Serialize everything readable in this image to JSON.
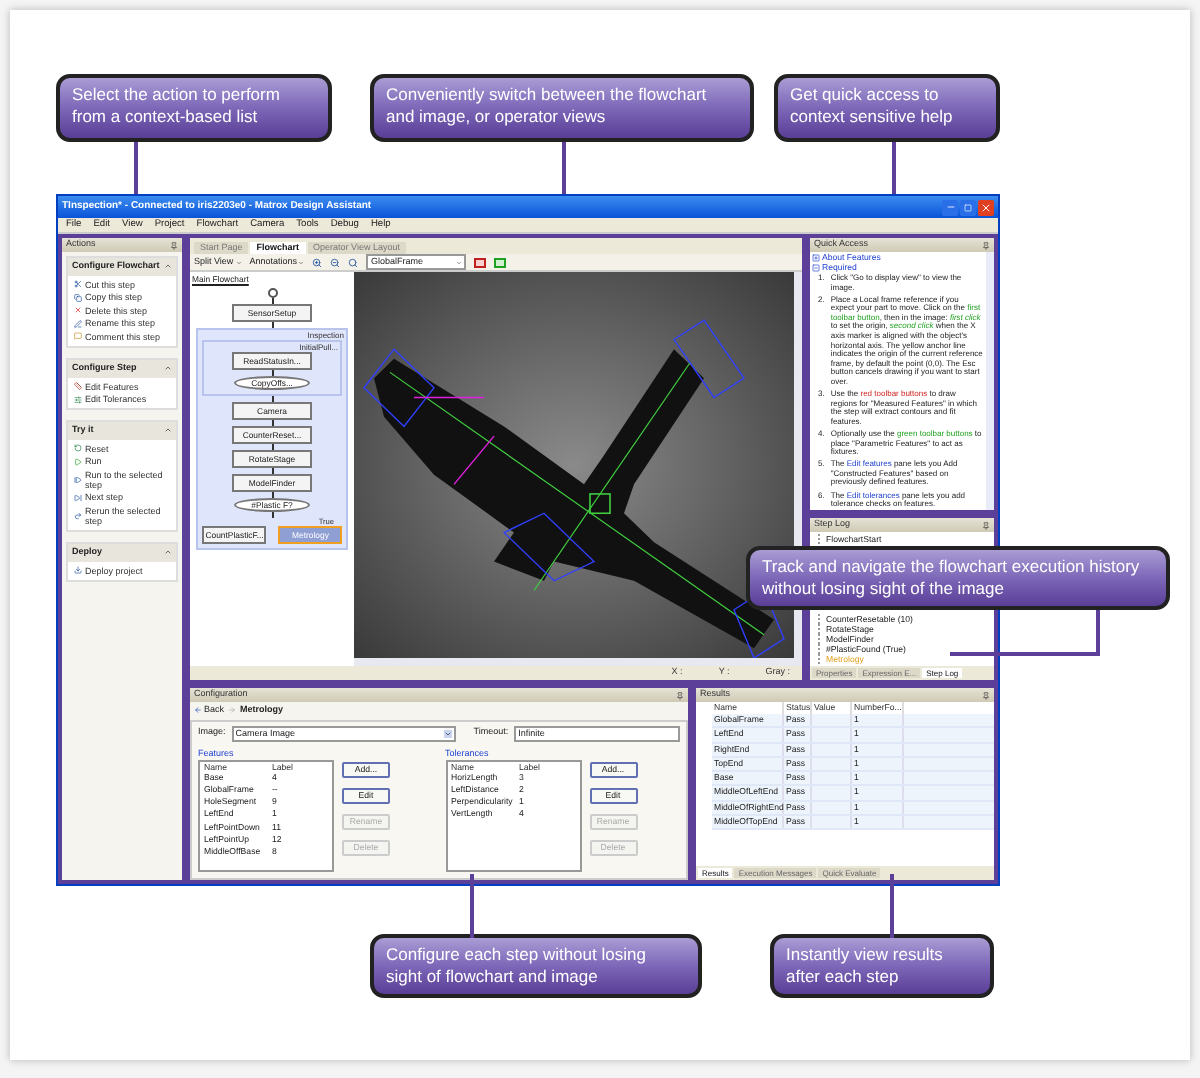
{
  "callouts_top": [
    {
      "text": "Select the action to perform from a context-based list"
    },
    {
      "text": "Conveniently switch between the flowchart and image, or operator views"
    },
    {
      "text": "Get quick access to context sensitive help"
    }
  ],
  "window": {
    "title": "TInspection* - Connected to iris2203e0 - Matrox Design Assistant",
    "menu": [
      "File",
      "Edit",
      "View",
      "Project",
      "Flowchart",
      "Camera",
      "Tools",
      "Debug",
      "Help"
    ]
  },
  "actions": {
    "title": "Actions",
    "sections": [
      {
        "title": "Configure Flowchart",
        "items": [
          "Cut this step",
          "Copy this step",
          "Delete this step",
          "Rename this step",
          "Comment this step"
        ]
      },
      {
        "title": "Configure Step",
        "items": [
          "Edit Features",
          "Edit Tolerances"
        ]
      },
      {
        "title": "Try it",
        "items": [
          "Reset",
          "Run",
          "Run to the selected step",
          "Next step",
          "Rerun the selected step"
        ]
      },
      {
        "title": "Deploy",
        "items": [
          "Deploy project"
        ]
      }
    ]
  },
  "center": {
    "tabs": [
      {
        "label": "Start Page",
        "selected": false
      },
      {
        "label": "Flowchart",
        "selected": true
      },
      {
        "label": "Operator View Layout",
        "selected": false
      }
    ],
    "toolbar": {
      "view": "Split View",
      "annotations": "Annotations",
      "frame": "GlobalFrame"
    },
    "flowchart": {
      "label": "Main Flowchart",
      "nodes": [
        {
          "kind": "start"
        },
        {
          "kind": "step",
          "label": "SensorSetup",
          "selected": false
        },
        {
          "kind": "group",
          "label": "Inspection",
          "children": [
            {
              "kind": "group",
              "label": "InitialPull...",
              "children": [
                {
                  "kind": "step",
                  "label": "ReadStatusIn...",
                  "selected": false
                },
                {
                  "kind": "decision",
                  "label": "CopyOffs..."
                }
              ]
            },
            {
              "kind": "step",
              "label": "Camera",
              "selected": false
            },
            {
              "kind": "step",
              "label": "CounterReset...",
              "selected": false
            },
            {
              "kind": "step",
              "label": "RotateStage",
              "selected": false
            },
            {
              "kind": "step",
              "label": "ModelFinder",
              "selected": false
            },
            {
              "kind": "decision",
              "label": "#Plastic F?"
            },
            {
              "kind": "branch",
              "label": "True",
              "children": [
                {
                  "kind": "step",
                  "label": "CountPlasticF...",
                  "selected": false
                },
                {
                  "kind": "step",
                  "label": "Metrology",
                  "selected": true
                }
              ]
            }
          ]
        }
      ]
    },
    "image_status": [
      "X :",
      "Y :",
      "Gray :"
    ]
  },
  "quick_access": {
    "title": "Quick Access",
    "links": [
      {
        "label": "About Features",
        "expanded": false
      },
      {
        "label": "Required",
        "expanded": true
      }
    ],
    "numbers": [
      "1.",
      "2.",
      "3.",
      "4.",
      "5.",
      "6."
    ],
    "steps": [
      [
        {
          "kind": "text",
          "text": "Click \"Go to display view\" to view the image."
        }
      ],
      [
        {
          "kind": "text",
          "text": "Place a Local frame reference if you expect your part to move. Click on the "
        },
        {
          "kind": "green",
          "text": "first toolbar button"
        },
        {
          "kind": "text",
          "text": ", then in the image: "
        },
        {
          "kind": "green_italic",
          "text": "first click"
        },
        {
          "kind": "text",
          "text": " to set the origin, "
        },
        {
          "kind": "green_italic",
          "text": "second click"
        },
        {
          "kind": "text",
          "text": " when the X axis marker is aligned with the object's horizontal axis. The yellow anchor line indicates the origin of the current reference frame, by default the point (0,0). The Esc button cancels drawing if you want to start over."
        }
      ],
      [
        {
          "kind": "text",
          "text": "Use the "
        },
        {
          "kind": "red",
          "text": "red toolbar buttons"
        },
        {
          "kind": "text",
          "text": " to draw regions for \"Measured Features\" in which the step will extract contours and fit features."
        }
      ],
      [
        {
          "kind": "text",
          "text": "Optionally use the "
        },
        {
          "kind": "green",
          "text": "green toolbar buttons"
        },
        {
          "kind": "text",
          "text": " to place \"Parametric Features\" to act as fixtures."
        }
      ],
      [
        {
          "kind": "text",
          "text": "The "
        },
        {
          "kind": "blue",
          "text": "Edit features"
        },
        {
          "kind": "text",
          "text": " pane lets you Add \"Constructed Features\" based on previously defined features."
        }
      ],
      [
        {
          "kind": "text",
          "text": "The "
        },
        {
          "kind": "blue",
          "text": "Edit tolerances"
        },
        {
          "kind": "text",
          "text": " pane lets you add tolerance checks on features."
        }
      ]
    ]
  },
  "step_log": {
    "title": "Step Log",
    "items": [
      {
        "label": "FlowchartStart",
        "selected": false
      },
      {
        "label": "CounterResetable (10)",
        "selected": false
      },
      {
        "label": "RotateStage",
        "selected": false
      },
      {
        "label": "ModelFinder",
        "selected": false
      },
      {
        "label": "#PlasticFound (True)",
        "selected": false
      },
      {
        "label": "Metrology",
        "selected": true
      }
    ],
    "tabs": [
      {
        "label": "Properties",
        "selected": false
      },
      {
        "label": "Expression E...",
        "selected": false
      },
      {
        "label": "Step Log",
        "selected": true
      }
    ]
  },
  "callout_side": {
    "text": "Track and navigate the flowchart execution history without losing sight of the image"
  },
  "configuration": {
    "title": "Configuration",
    "back": "Back",
    "step": "Metrology",
    "image_label": "Image:",
    "image_value": "Camera Image",
    "timeout_label": "Timeout:",
    "timeout_value": "Infinite",
    "features": {
      "title": "Features",
      "columns": [
        "Name",
        "Label"
      ],
      "rows": [
        [
          "Base",
          "4"
        ],
        [
          "GlobalFrame",
          "--"
        ],
        [
          "HoleSegment",
          "9"
        ],
        [
          "LeftEnd",
          "1"
        ],
        [
          "LeftPointDown",
          "11"
        ],
        [
          "LeftPointUp",
          "12"
        ],
        [
          "MiddleOffBase",
          "8"
        ]
      ],
      "buttons": [
        {
          "label": "Add...",
          "disabled": false
        },
        {
          "label": "Edit",
          "disabled": false
        },
        {
          "label": "Rename",
          "disabled": true
        },
        {
          "label": "Delete",
          "disabled": true
        }
      ]
    },
    "tolerances": {
      "title": "Tolerances",
      "columns": [
        "Name",
        "Label"
      ],
      "rows": [
        [
          "HorizLength",
          "3"
        ],
        [
          "LeftDistance",
          "2"
        ],
        [
          "Perpendicularity",
          "1"
        ],
        [
          "VertLength",
          "4"
        ]
      ],
      "buttons": [
        {
          "label": "Add...",
          "disabled": false
        },
        {
          "label": "Edit",
          "disabled": false
        },
        {
          "label": "Rename",
          "disabled": true
        },
        {
          "label": "Delete",
          "disabled": true
        }
      ]
    }
  },
  "results": {
    "title": "Results",
    "columns": [
      "Name",
      "Status",
      "Value",
      "NumberFo..."
    ],
    "rows": [
      [
        "GlobalFrame",
        "Pass",
        "",
        "1"
      ],
      [
        "LeftEnd",
        "Pass",
        "",
        "1"
      ],
      [
        "RightEnd",
        "Pass",
        "",
        "1"
      ],
      [
        "TopEnd",
        "Pass",
        "",
        "1"
      ],
      [
        "Base",
        "Pass",
        "",
        "1"
      ],
      [
        "MiddleOfLeftEnd",
        "Pass",
        "",
        "1"
      ],
      [
        "MiddleOfRightEnd",
        "Pass",
        "",
        "1"
      ],
      [
        "MiddleOfTopEnd",
        "Pass",
        "",
        "1"
      ]
    ],
    "tabs": [
      {
        "label": "Results",
        "selected": true
      },
      {
        "label": "Execution Messages",
        "selected": false
      },
      {
        "label": "Quick Evaluate",
        "selected": false
      }
    ]
  },
  "callouts_bottom": [
    {
      "text": "Configure each step without losing sight of flowchart and image"
    },
    {
      "text": "Instantly view results after each step"
    }
  ]
}
